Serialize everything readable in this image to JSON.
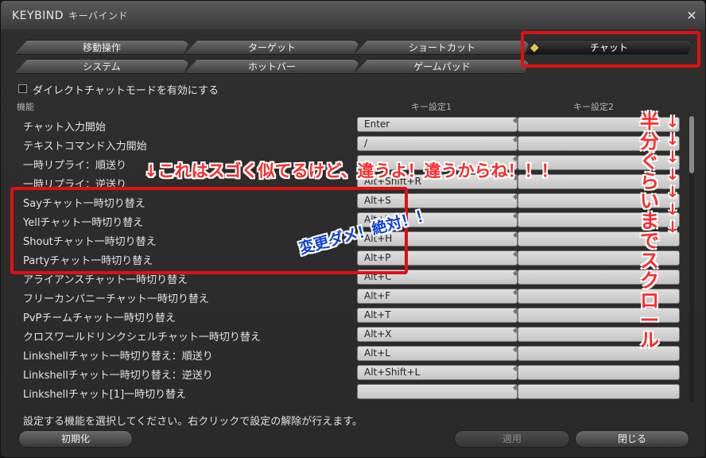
{
  "window": {
    "title": "KEYBIND",
    "subtitle": "キーバインド",
    "close_icon": "close-crossed-icon"
  },
  "tabs": [
    {
      "label": "移動操作",
      "active": false
    },
    {
      "label": "ターゲット",
      "active": false
    },
    {
      "label": "ショートカット",
      "active": false
    },
    {
      "label": "チャット",
      "active": true
    },
    {
      "label": "システム",
      "active": false
    },
    {
      "label": "ホットバー",
      "active": false
    },
    {
      "label": "ゲームパッド",
      "active": false
    }
  ],
  "direct_chat": {
    "label": "ダイレクトチャットモードを有効にする",
    "checked": false
  },
  "columns": {
    "function": "機能",
    "key1": "キー設定1",
    "key2": "キー設定2"
  },
  "rows": [
    {
      "name": "チャット入力開始",
      "key1": "Enter",
      "key2": ""
    },
    {
      "name": "テキストコマンド入力開始",
      "key1": "/",
      "key2": ""
    },
    {
      "name": "一時リプライ：順送り",
      "key1": "",
      "key2": ""
    },
    {
      "name": "一時リプライ：逆送り",
      "key1": "Alt+Shift+R",
      "key2": ""
    },
    {
      "name": "Sayチャット一時切り替え",
      "key1": "Alt+S",
      "key2": ""
    },
    {
      "name": "Yellチャット一時切り替え",
      "key1": "Alt+Y",
      "key2": ""
    },
    {
      "name": "Shoutチャット一時切り替え",
      "key1": "Alt+H",
      "key2": ""
    },
    {
      "name": "Partyチャット一時切り替え",
      "key1": "Alt+P",
      "key2": ""
    },
    {
      "name": "アライアンスチャット一時切り替え",
      "key1": "Alt+C",
      "key2": ""
    },
    {
      "name": "フリーカンパニーチャット一時切り替え",
      "key1": "Alt+F",
      "key2": ""
    },
    {
      "name": "PvPチームチャット一時切り替え",
      "key1": "Alt+T",
      "key2": ""
    },
    {
      "name": "クロスワールドリンクシェルチャット一時切り替え",
      "key1": "Alt+X",
      "key2": ""
    },
    {
      "name": "Linkshellチャット一時切り替え：順送り",
      "key1": "Alt+L",
      "key2": ""
    },
    {
      "name": "Linkshellチャット一時切り替え：逆送り",
      "key1": "Alt+Shift+L",
      "key2": ""
    },
    {
      "name": "Linkshellチャット[1]一時切り替え",
      "key1": "",
      "key2": ""
    }
  ],
  "help_text": "設定する機能を選択してください。右クリックで設定の解除が行えます。",
  "buttons": {
    "reset": "初期化",
    "apply": "適用",
    "close": "閉じる"
  },
  "annotations": {
    "similar_warning": "↓これはスゴく似てるけど、違うよ！違うからね！！！",
    "no_change": "変更ダメ！絶対！！",
    "scroll_note": "半分ぐらいまでスクロール",
    "arrows": "↓↓↓↓↓↓↓",
    "color_red": "#e01010",
    "color_blue": "#1040d8"
  },
  "scroll": {
    "position_fraction": 0.0,
    "visible_fraction": 0.2
  }
}
